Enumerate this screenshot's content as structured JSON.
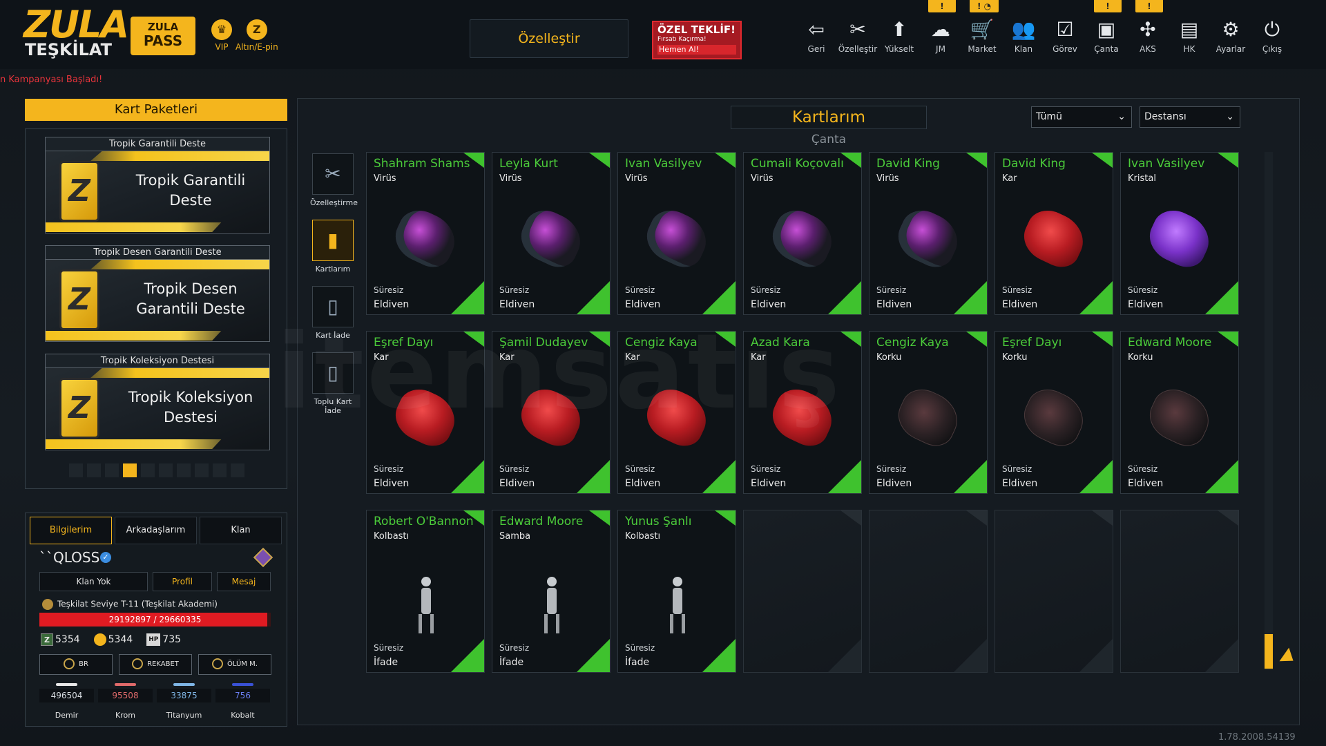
{
  "header": {
    "logo_line1": "ZULA",
    "logo_line2": "TEŞKİLAT",
    "pass_line1": "ZULA",
    "pass_line2": "PASS",
    "vip_label": "VIP",
    "gold_label": "Altın/E-pin",
    "customize_label": "Özelleştir",
    "offer_title": "ÖZEL TEKLİF!",
    "offer_sub": "Fırsatı Kaçırma!",
    "offer_cta": "Hemen Al!",
    "nav": [
      {
        "label": "Geri",
        "icon": "back-icon",
        "glyph": "⇦"
      },
      {
        "label": "Özelleştir",
        "icon": "tools-icon",
        "glyph": "✂"
      },
      {
        "label": "Yükselt",
        "icon": "upgrade-icon",
        "glyph": "⬆"
      },
      {
        "label": "JM",
        "icon": "coins-icon",
        "glyph": "☁"
      },
      {
        "label": "Market",
        "icon": "cart-icon",
        "glyph": "🛒"
      },
      {
        "label": "Klan",
        "icon": "clan-icon",
        "glyph": "👥"
      },
      {
        "label": "Görev",
        "icon": "task-icon",
        "glyph": "☑"
      },
      {
        "label": "Çanta",
        "icon": "bag-icon",
        "glyph": "▣"
      },
      {
        "label": "AKS",
        "icon": "aks-icon",
        "glyph": "✣"
      },
      {
        "label": "HK",
        "icon": "wallet-icon",
        "glyph": "▤"
      },
      {
        "label": "Ayarlar",
        "icon": "gear-icon",
        "glyph": "⚙"
      },
      {
        "label": "Çıkış",
        "icon": "power-icon",
        "glyph": "⏻"
      }
    ],
    "badges": [
      "!",
      "! ◔",
      "!",
      "!"
    ],
    "campaign_text": "n Kampanyası Başladı!"
  },
  "packs": {
    "title": "Kart Paketleri",
    "items": [
      {
        "header": "Tropik Garantili Deste",
        "name": "Tropik Garantili Deste"
      },
      {
        "header": "Tropik Desen Garantili Deste",
        "name": "Tropik Desen Garantili Deste"
      },
      {
        "header": "Tropik Koleksiyon Destesi",
        "name": "Tropik Koleksiyon Destesi"
      }
    ],
    "page_count": 10,
    "active_page": 4
  },
  "profile": {
    "tabs": [
      "Bilgilerim",
      "Arkadaşlarım",
      "Klan"
    ],
    "username": "``QLOSS",
    "buttons": [
      "Klan Yok",
      "Profil",
      "Mesaj"
    ],
    "level_text": "Teşkilat Seviye T-11 (Teşkilat Akademi)",
    "xp_text": "29192897 / 29660335",
    "xp_progress": 0.984,
    "currencies": [
      {
        "icon": "zula-coin-icon",
        "glyph": "Z",
        "value": "5354"
      },
      {
        "icon": "gold-coin-icon",
        "glyph": "●",
        "value": "5344"
      },
      {
        "icon": "hp-icon",
        "glyph": "HP",
        "value": "735"
      }
    ],
    "modes": [
      "BR",
      "REKABET",
      "ÖLÜM M."
    ],
    "materials": [
      {
        "name": "Demir",
        "value": "496504",
        "color": "#e8e8e8"
      },
      {
        "name": "Krom",
        "value": "95508",
        "color": "#e06a6a"
      },
      {
        "name": "Titanyum",
        "value": "33875",
        "color": "#7fb6e6"
      },
      {
        "name": "Kobalt",
        "value": "756",
        "color": "#3a52d6"
      }
    ]
  },
  "main": {
    "title": "Kartlarım",
    "subtitle": "Çanta",
    "filter1": "Tümü",
    "filter2": "Destansı",
    "tools": [
      {
        "label": "Özelleştirme",
        "icon": "tools-icon",
        "glyph": "✂"
      },
      {
        "label": "Kartlarım",
        "icon": "cards-icon",
        "glyph": "▮"
      },
      {
        "label": "Kart İade",
        "icon": "card-return-icon",
        "glyph": "▯"
      },
      {
        "label": "Toplu Kart İade",
        "icon": "bulk-return-icon",
        "glyph": "▯"
      }
    ],
    "cards": [
      {
        "name": "Shahram Shams",
        "category": "Virüs",
        "duration": "Süresiz",
        "type": "Eldiven",
        "kind": "virus"
      },
      {
        "name": "Leyla Kurt",
        "category": "Virüs",
        "duration": "Süresiz",
        "type": "Eldiven",
        "kind": "virus"
      },
      {
        "name": "Ivan Vasilyev",
        "category": "Virüs",
        "duration": "Süresiz",
        "type": "Eldiven",
        "kind": "virus"
      },
      {
        "name": "Cumali Koçovalı",
        "category": "Virüs",
        "duration": "Süresiz",
        "type": "Eldiven",
        "kind": "virus"
      },
      {
        "name": "David King",
        "category": "Virüs",
        "duration": "Süresiz",
        "type": "Eldiven",
        "kind": "virus"
      },
      {
        "name": "David King",
        "category": "Kar",
        "duration": "Süresiz",
        "type": "Eldiven",
        "kind": "kar"
      },
      {
        "name": "Ivan Vasilyev",
        "category": "Kristal",
        "duration": "Süresiz",
        "type": "Eldiven",
        "kind": "kristal"
      },
      {
        "name": "Eşref Dayı",
        "category": "Kar",
        "duration": "Süresiz",
        "type": "Eldiven",
        "kind": "kar"
      },
      {
        "name": "Şamil Dudayev",
        "category": "Kar",
        "duration": "Süresiz",
        "type": "Eldiven",
        "kind": "kar"
      },
      {
        "name": "Cengiz Kaya",
        "category": "Kar",
        "duration": "Süresiz",
        "type": "Eldiven",
        "kind": "kar"
      },
      {
        "name": "Azad Kara",
        "category": "Kar",
        "duration": "Süresiz",
        "type": "Eldiven",
        "kind": "kar"
      },
      {
        "name": "Cengiz Kaya",
        "category": "Korku",
        "duration": "Süresiz",
        "type": "Eldiven",
        "kind": "korku"
      },
      {
        "name": "Eşref Dayı",
        "category": "Korku",
        "duration": "Süresiz",
        "type": "Eldiven",
        "kind": "korku"
      },
      {
        "name": "Edward Moore",
        "category": "Korku",
        "duration": "Süresiz",
        "type": "Eldiven",
        "kind": "korku"
      },
      {
        "name": "Robert O'Bannon",
        "category": "Kolbastı",
        "duration": "Süresiz",
        "type": "İfade",
        "kind": "emote"
      },
      {
        "name": "Edward Moore",
        "category": "Samba",
        "duration": "Süresiz",
        "type": "İfade",
        "kind": "emote"
      },
      {
        "name": "Yunus Şanlı",
        "category": "Kolbastı",
        "duration": "Süresiz",
        "type": "İfade",
        "kind": "emote"
      }
    ],
    "empty_slots": 4
  },
  "watermark": "itemsatış",
  "version": "1.78.2008.54139"
}
